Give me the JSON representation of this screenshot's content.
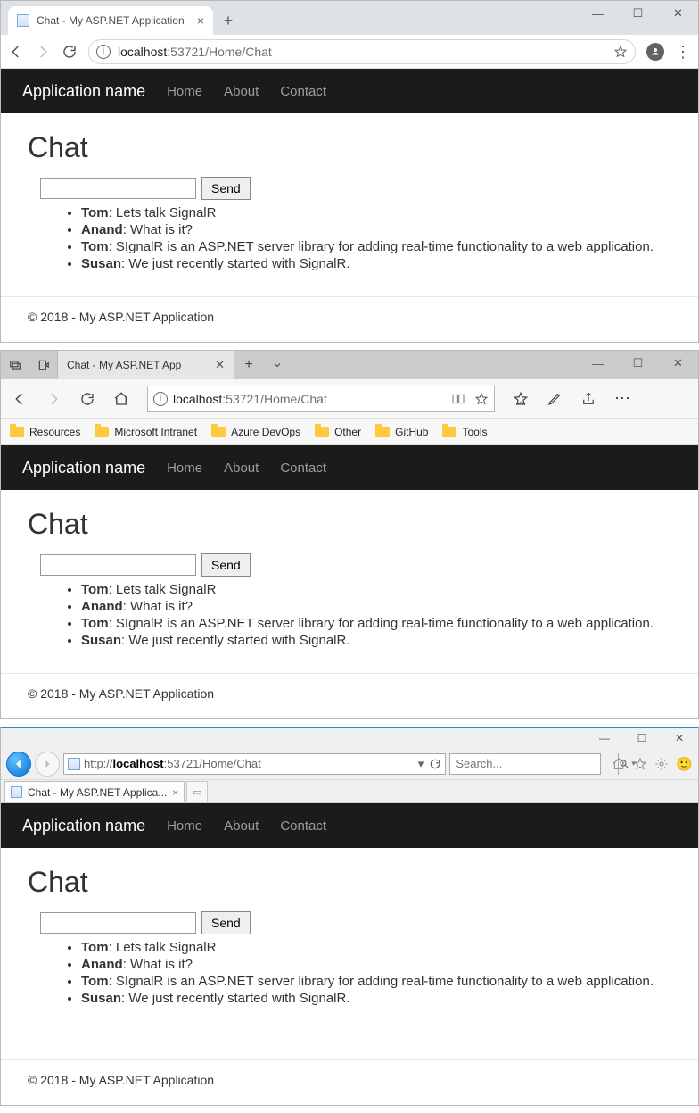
{
  "chrome": {
    "tab_title": "Chat - My ASP.NET Application",
    "url_host": "localhost",
    "url_port_path": ":53721/Home/Chat"
  },
  "edge": {
    "tab_title": "Chat - My ASP.NET App",
    "url_host": "localhost",
    "url_port_path": ":53721/Home/Chat",
    "bookmarks": [
      "Resources",
      "Microsoft Intranet",
      "Azure DevOps",
      "Other",
      "GitHub",
      "Tools"
    ]
  },
  "ie": {
    "tab_title": "Chat - My ASP.NET Applica...",
    "url_prefix": "http://",
    "url_host": "localhost",
    "url_port_path": ":53721/Home/Chat",
    "search_placeholder": "Search..."
  },
  "app": {
    "brand": "Application name",
    "nav": {
      "home": "Home",
      "about": "About",
      "contact": "Contact"
    },
    "heading": "Chat",
    "send_label": "Send",
    "messages": [
      {
        "user": "Tom",
        "text": "Lets talk SignalR"
      },
      {
        "user": "Anand",
        "text": "What is it?"
      },
      {
        "user": "Tom",
        "text": "SIgnalR is an ASP.NET server library for adding real-time functionality to a web application."
      },
      {
        "user": "Susan",
        "text": "We just recently started with SignalR."
      }
    ],
    "footer": "© 2018 - My ASP.NET Application"
  }
}
